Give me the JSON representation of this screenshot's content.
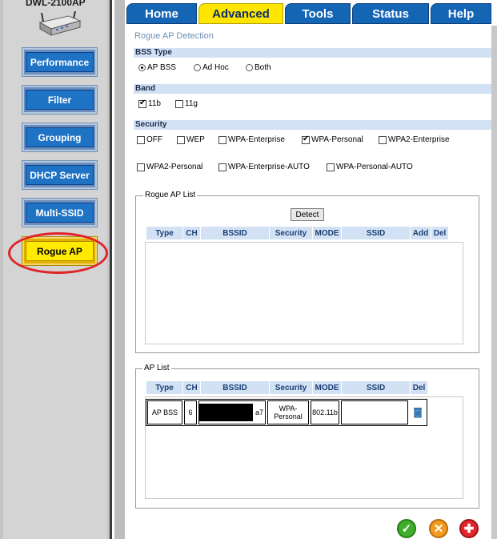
{
  "sidebar": {
    "model": "DWL-2100AP",
    "buttons": [
      {
        "label": "Performance"
      },
      {
        "label": "Filter"
      },
      {
        "label": "Grouping"
      },
      {
        "label": "DHCP Server"
      },
      {
        "label": "Multi-SSID"
      },
      {
        "label": "Rogue AP",
        "active": true
      }
    ]
  },
  "tabs": [
    {
      "label": "Home"
    },
    {
      "label": "Advanced",
      "active": true
    },
    {
      "label": "Tools"
    },
    {
      "label": "Status"
    },
    {
      "label": "Help"
    }
  ],
  "page": {
    "title": "Rogue AP Detection",
    "bss_type": {
      "label": "BSS Type",
      "options": [
        "AP BSS",
        "Ad Hoc",
        "Both"
      ],
      "selected": "AP BSS"
    },
    "band": {
      "label": "Band",
      "options": [
        {
          "label": "11b",
          "checked": true
        },
        {
          "label": "11g",
          "checked": false
        }
      ]
    },
    "security": {
      "label": "Security",
      "options": [
        {
          "label": "OFF",
          "checked": false
        },
        {
          "label": "WEP",
          "checked": false
        },
        {
          "label": "WPA-Enterprise",
          "checked": false
        },
        {
          "label": "WPA-Personal",
          "checked": true
        },
        {
          "label": "WPA2-Enterprise",
          "checked": false
        },
        {
          "label": "WPA2-Personal",
          "checked": false
        },
        {
          "label": "WPA-Enterprise-AUTO",
          "checked": false
        },
        {
          "label": "WPA-Personal-AUTO",
          "checked": false
        }
      ]
    },
    "rogue_list": {
      "legend": "Rogue AP List",
      "detect_label": "Detect",
      "columns": [
        "Type",
        "CH",
        "BSSID",
        "Security",
        "MODE",
        "SSID",
        "Add",
        "Del"
      ]
    },
    "ap_list": {
      "legend": "AP List",
      "columns": [
        "Type",
        "CH",
        "BSSID",
        "Security",
        "MODE",
        "SSID",
        "Del"
      ],
      "rows": [
        {
          "type": "AP BSS",
          "ch": "6",
          "bssid_suffix": "a7",
          "security": "WPA-Personal",
          "mode": "802.11b",
          "ssid": ""
        }
      ]
    }
  },
  "colors": {
    "tab_blue": "#1565b5",
    "tab_active": "#ffe600",
    "band_bg": "#d2e1f4",
    "highlight": "#e0242a"
  },
  "icons": [
    "apply-icon",
    "cancel-icon",
    "help-icon",
    "delete-icon"
  ]
}
